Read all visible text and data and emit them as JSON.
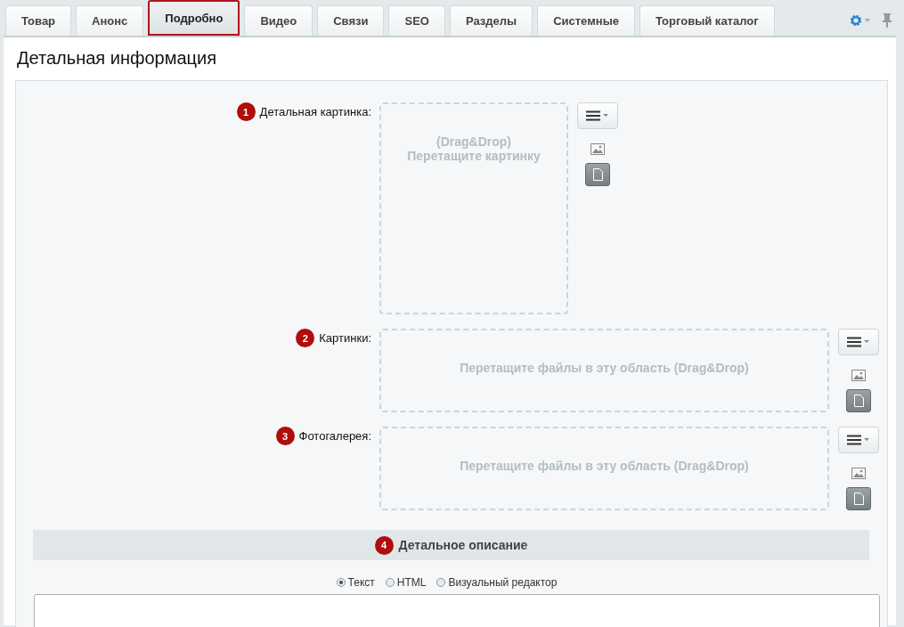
{
  "tabs": [
    {
      "label": "Товар",
      "selected": false
    },
    {
      "label": "Анонс",
      "selected": false
    },
    {
      "label": "Подробно",
      "selected": true
    },
    {
      "label": "Видео",
      "selected": false
    },
    {
      "label": "Связи",
      "selected": false
    },
    {
      "label": "SEO",
      "selected": false
    },
    {
      "label": "Разделы",
      "selected": false
    },
    {
      "label": "Системные",
      "selected": false
    },
    {
      "label": "Торговый каталог",
      "selected": false
    }
  ],
  "panel_title": "Детальная информация",
  "fields": [
    {
      "badge": "1",
      "label": "Детальная картинка:",
      "kind": "single",
      "drop_lines": [
        "(Drag&Drop)",
        "Перетащите картинку"
      ],
      "modes": [
        {
          "kind": "image",
          "selected": false
        },
        {
          "kind": "file",
          "selected": true
        }
      ]
    },
    {
      "badge": "2",
      "label": "Картинки:",
      "kind": "multi",
      "drop_lines": [
        "Перетащите файлы в эту область (Drag&Drop)"
      ],
      "modes": [
        {
          "kind": "image",
          "selected": false
        },
        {
          "kind": "file",
          "selected": true
        }
      ]
    },
    {
      "badge": "3",
      "label": "Фотогалерея:",
      "kind": "multi",
      "drop_lines": [
        "Перетащите файлы в эту область (Drag&Drop)"
      ],
      "modes": [
        {
          "kind": "image",
          "selected": false
        },
        {
          "kind": "file",
          "selected": true
        }
      ]
    }
  ],
  "section": {
    "badge": "4",
    "title": "Детальное описание"
  },
  "editor_modes": [
    {
      "label": "Текст",
      "selected": true
    },
    {
      "label": "HTML",
      "selected": false
    },
    {
      "label": "Визуальный редактор",
      "selected": false
    }
  ]
}
